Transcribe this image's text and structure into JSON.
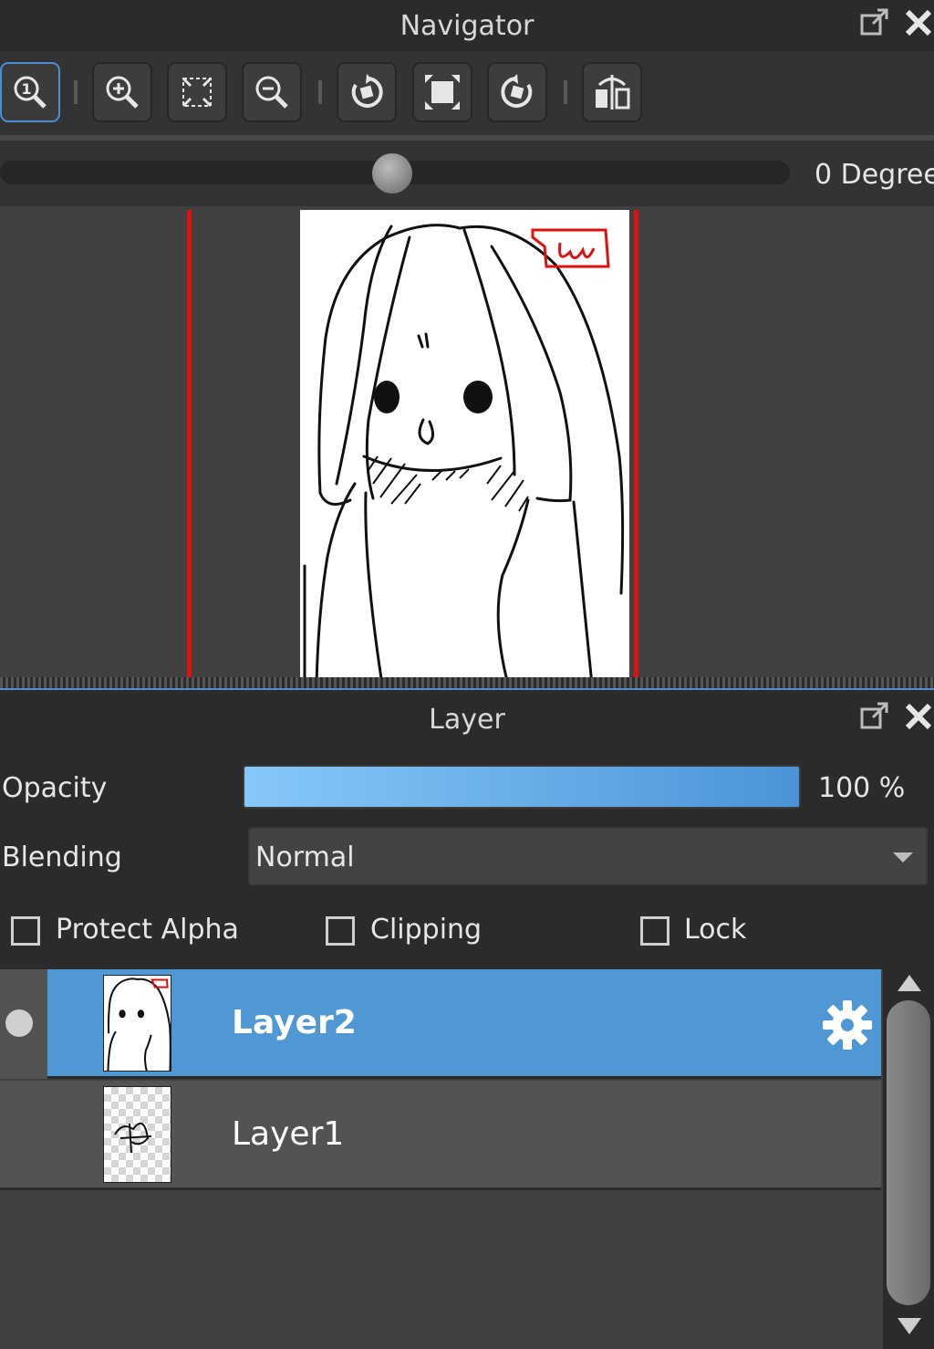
{
  "navigator": {
    "title": "Navigator",
    "toolbar": [
      {
        "icon": "zoom-actual-size-icon",
        "active": true
      },
      {
        "icon": "zoom-in-icon"
      },
      {
        "icon": "fit-to-window-icon"
      },
      {
        "icon": "zoom-out-icon"
      },
      {
        "icon": "rotate-left-icon"
      },
      {
        "icon": "reset-view-icon"
      },
      {
        "icon": "rotate-right-icon"
      },
      {
        "icon": "flip-horizontal-icon"
      }
    ],
    "rotation_label": "0 Degree",
    "rotation_value": 0
  },
  "layer_panel": {
    "title": "Layer",
    "opacity_label": "Opacity",
    "opacity_value": "100 %",
    "opacity_fraction": 1.0,
    "blending_label": "Blending",
    "blending_value": "Normal",
    "protect_alpha_label": "Protect Alpha",
    "clipping_label": "Clipping",
    "lock_label": "Lock",
    "protect_alpha_checked": false,
    "clipping_checked": false,
    "lock_checked": false,
    "layers": [
      {
        "name": "Layer2",
        "selected": true
      },
      {
        "name": "Layer1",
        "selected": false
      }
    ]
  },
  "colors": {
    "accent": "#4f98d4",
    "canvas_border": "#e01010",
    "background": "#2b2b2b"
  }
}
